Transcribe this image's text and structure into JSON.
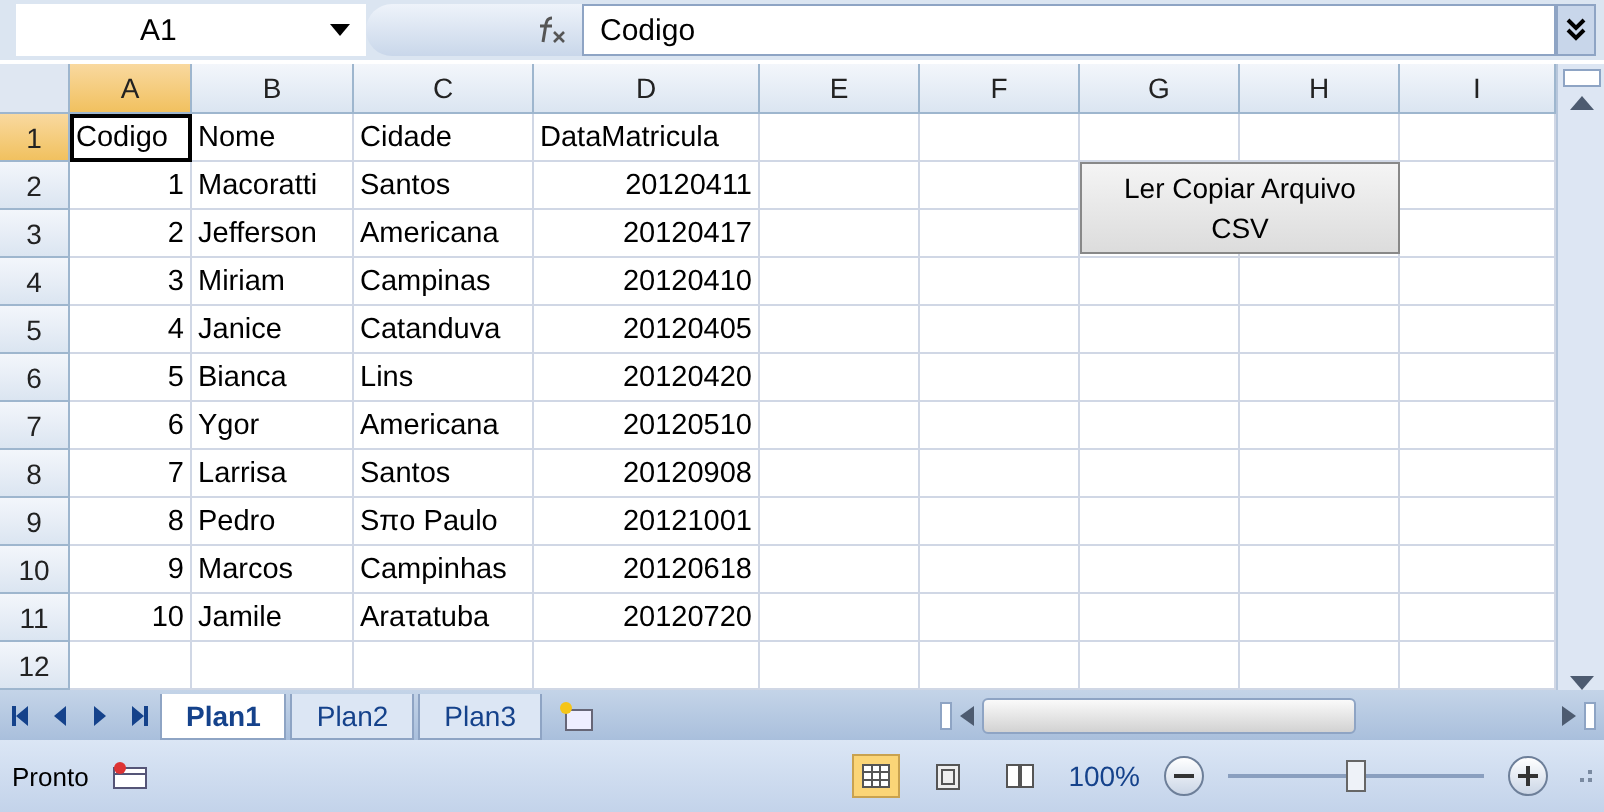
{
  "formula_bar": {
    "name_box": "A1",
    "formula": "Codigo"
  },
  "columns": [
    {
      "label": "A",
      "selected": true
    },
    {
      "label": "B",
      "selected": false
    },
    {
      "label": "C",
      "selected": false
    },
    {
      "label": "D",
      "selected": false
    },
    {
      "label": "E",
      "selected": false
    },
    {
      "label": "F",
      "selected": false
    },
    {
      "label": "G",
      "selected": false
    },
    {
      "label": "H",
      "selected": false
    },
    {
      "label": "I",
      "selected": false
    }
  ],
  "rows": [
    {
      "number": "1",
      "selected": true,
      "cells": [
        {
          "text": "Codigo",
          "numeric": false
        },
        {
          "text": "Nome",
          "numeric": false
        },
        {
          "text": "Cidade",
          "numeric": false
        },
        {
          "text": "DataMatricula",
          "numeric": false
        }
      ]
    },
    {
      "number": "2",
      "selected": false,
      "cells": [
        {
          "text": "1",
          "numeric": true
        },
        {
          "text": "Macoratti",
          "numeric": false
        },
        {
          "text": "Santos",
          "numeric": false
        },
        {
          "text": "20120411",
          "numeric": true
        }
      ]
    },
    {
      "number": "3",
      "selected": false,
      "cells": [
        {
          "text": "2",
          "numeric": true
        },
        {
          "text": "Jefferson",
          "numeric": false
        },
        {
          "text": "Americana",
          "numeric": false
        },
        {
          "text": "20120417",
          "numeric": true
        }
      ]
    },
    {
      "number": "4",
      "selected": false,
      "cells": [
        {
          "text": "3",
          "numeric": true
        },
        {
          "text": "Miriam",
          "numeric": false
        },
        {
          "text": "Campinas",
          "numeric": false
        },
        {
          "text": "20120410",
          "numeric": true
        }
      ]
    },
    {
      "number": "5",
      "selected": false,
      "cells": [
        {
          "text": "4",
          "numeric": true
        },
        {
          "text": "Janice",
          "numeric": false
        },
        {
          "text": "Catanduva",
          "numeric": false
        },
        {
          "text": "20120405",
          "numeric": true
        }
      ]
    },
    {
      "number": "6",
      "selected": false,
      "cells": [
        {
          "text": "5",
          "numeric": true
        },
        {
          "text": "Bianca",
          "numeric": false
        },
        {
          "text": "Lins",
          "numeric": false
        },
        {
          "text": "20120420",
          "numeric": true
        }
      ]
    },
    {
      "number": "7",
      "selected": false,
      "cells": [
        {
          "text": "6",
          "numeric": true
        },
        {
          "text": "Ygor",
          "numeric": false
        },
        {
          "text": "Americana",
          "numeric": false
        },
        {
          "text": "20120510",
          "numeric": true
        }
      ]
    },
    {
      "number": "8",
      "selected": false,
      "cells": [
        {
          "text": "7",
          "numeric": true
        },
        {
          "text": "Larrisa",
          "numeric": false
        },
        {
          "text": "Santos",
          "numeric": false
        },
        {
          "text": "20120908",
          "numeric": true
        }
      ]
    },
    {
      "number": "9",
      "selected": false,
      "cells": [
        {
          "text": "8",
          "numeric": true
        },
        {
          "text": "Pedro",
          "numeric": false
        },
        {
          "text": "Sπo Paulo",
          "numeric": false
        },
        {
          "text": "20121001",
          "numeric": true
        }
      ]
    },
    {
      "number": "10",
      "selected": false,
      "cells": [
        {
          "text": "9",
          "numeric": true
        },
        {
          "text": "Marcos",
          "numeric": false
        },
        {
          "text": "Campinhas",
          "numeric": false
        },
        {
          "text": "20120618",
          "numeric": true
        }
      ]
    },
    {
      "number": "11",
      "selected": false,
      "cells": [
        {
          "text": "10",
          "numeric": true
        },
        {
          "text": "Jamile",
          "numeric": false
        },
        {
          "text": "Araτatuba",
          "numeric": false
        },
        {
          "text": "20120720",
          "numeric": true
        }
      ]
    },
    {
      "number": "12",
      "selected": false,
      "cells": []
    }
  ],
  "sheet_button": {
    "label": "Ler Copiar Arquivo CSV"
  },
  "sheet_tabs": [
    {
      "label": "Plan1",
      "selected": true
    },
    {
      "label": "Plan2",
      "selected": false
    },
    {
      "label": "Plan3",
      "selected": false
    }
  ],
  "status_bar": {
    "status": "Pronto",
    "views": [
      {
        "kind": "normal",
        "selected": true
      },
      {
        "kind": "layout",
        "selected": false
      },
      {
        "kind": "pagebreak",
        "selected": false
      }
    ],
    "zoom": "100%",
    "zoom_slider": {
      "level": 0.5
    }
  }
}
